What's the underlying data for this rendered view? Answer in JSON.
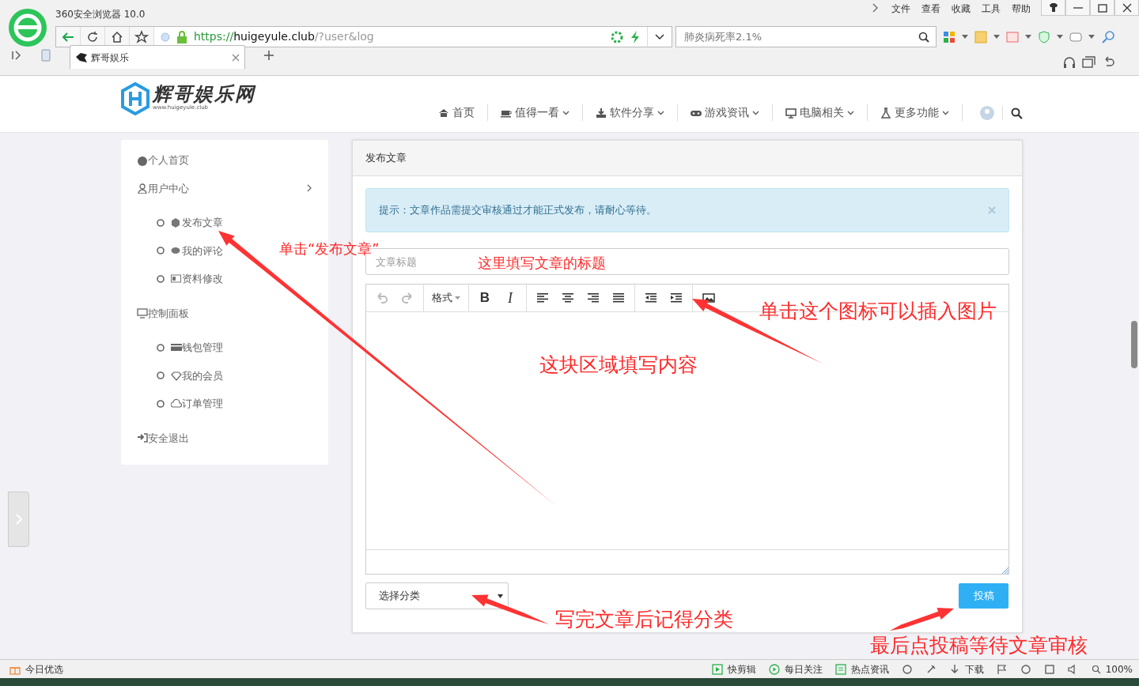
{
  "browser": {
    "title": "360安全浏览器 10.0",
    "menu": [
      "文件",
      "查看",
      "收藏",
      "工具",
      "帮助"
    ],
    "url": {
      "scheme": "https://",
      "host": "huigeyule.club",
      "path": "/?user&log"
    },
    "search": {
      "placeholder": "肺炎病死率2.1%"
    },
    "tabs": [
      {
        "label": "辉哥娱乐",
        "selected": true
      }
    ]
  },
  "site": {
    "logo_text": "辉哥娱乐网",
    "logo_sub": "www.huigeyule.club",
    "nav": [
      {
        "label": "首页",
        "dropdown": false
      },
      {
        "label": "值得一看",
        "dropdown": true
      },
      {
        "label": "软件分享",
        "dropdown": true
      },
      {
        "label": "游戏资讯",
        "dropdown": true
      },
      {
        "label": "电脑相关",
        "dropdown": true
      },
      {
        "label": "更多功能",
        "dropdown": true
      }
    ]
  },
  "sidebar": {
    "items": [
      {
        "label": "个人首页",
        "chevron": false
      },
      {
        "label": "用户中心",
        "chevron": true,
        "children": [
          {
            "label": "发布文章"
          },
          {
            "label": "我的评论"
          },
          {
            "label": "资料修改"
          }
        ]
      },
      {
        "label": "控制面板",
        "chevron": false,
        "children": [
          {
            "label": "钱包管理"
          },
          {
            "label": "我的会员"
          },
          {
            "label": "订单管理"
          }
        ]
      },
      {
        "label": "安全退出",
        "chevron": false
      }
    ]
  },
  "panel": {
    "title": "发布文章",
    "alert": "提示：文章作品需提交审核通过才能正式发布，请耐心等待。",
    "title_field": {
      "placeholder": "文章标题"
    },
    "toolbar": {
      "format": "格式",
      "bold": "B",
      "italic": "I"
    },
    "category": {
      "placeholder": "选择分类"
    },
    "submit": "投稿"
  },
  "annotations": [
    "单击“发布文章”",
    "这里填写文章的标题",
    "单击这个图标可以插入图片",
    "这块区域填写内容",
    "写完文章后记得分类",
    "最后点投稿等待文章审核"
  ],
  "status_bar": {
    "left": "今日优选",
    "items": [
      "快剪辑",
      "每日关注",
      "热点资讯",
      "下载"
    ],
    "zoom": "100%"
  }
}
